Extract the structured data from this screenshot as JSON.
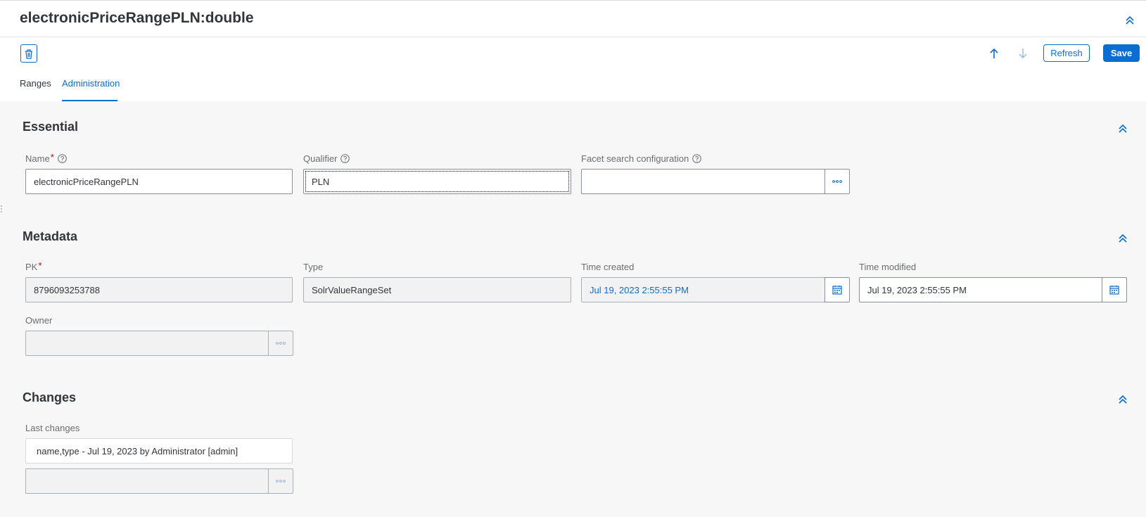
{
  "header": {
    "title": "electronicPriceRangePLN:double",
    "refresh_label": "Refresh",
    "save_label": "Save"
  },
  "tabs": [
    {
      "label": "Ranges",
      "active": false
    },
    {
      "label": "Administration",
      "active": true
    }
  ],
  "essential": {
    "title": "Essential",
    "name": {
      "label": "Name",
      "value": "electronicPriceRangePLN",
      "required": true
    },
    "qualifier": {
      "label": "Qualifier",
      "value": "PLN"
    },
    "facet_search_configuration": {
      "label": "Facet search configuration",
      "value": ""
    }
  },
  "metadata": {
    "title": "Metadata",
    "pk": {
      "label": "PK",
      "value": "8796093253788",
      "required": true
    },
    "type": {
      "label": "Type",
      "value": "SolrValueRangeSet"
    },
    "time_created": {
      "label": "Time created",
      "value": "Jul 19, 2023 2:55:55 PM"
    },
    "time_modified": {
      "label": "Time modified",
      "value": "Jul 19, 2023 2:55:55 PM"
    },
    "owner": {
      "label": "Owner",
      "value": ""
    }
  },
  "changes": {
    "title": "Changes",
    "last_changes": {
      "label": "Last changes",
      "value": "name,type - Jul 19, 2023 by Administrator [admin]",
      "reference_value": ""
    }
  },
  "colors": {
    "accent": "#0a6ed1",
    "required": "#bb0000"
  }
}
